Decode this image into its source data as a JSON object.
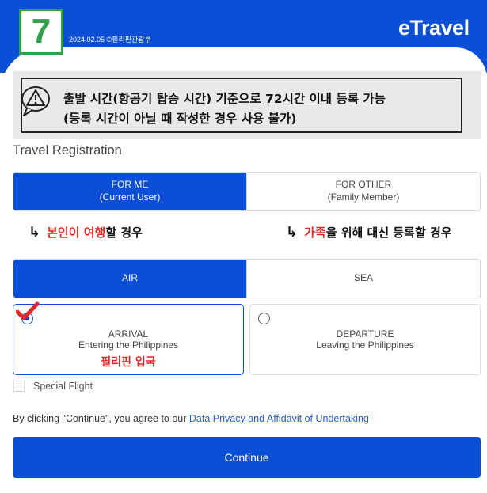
{
  "header": {
    "step_number": "7",
    "date_credit": "2024.02.05 ©필리핀관광부",
    "logo_text": "eTravel"
  },
  "notice": {
    "line1_before": "출발 시간(항공기 탑승 시간) 기준으로 ",
    "line1_highlight": "72시간 이내",
    "line1_after": " 등록 가능",
    "line2": "(등록 시간이 아닐 때 작성한 경우 사용 불가)",
    "icon": "warning-icon"
  },
  "form": {
    "title": "Travel Registration",
    "registrant": {
      "for_me_line1": "FOR ME",
      "for_me_line2": "(Current User)",
      "for_other_line1": "FOR OTHER",
      "for_other_line2": "(Family Member)",
      "selected": "FOR ME"
    },
    "notes": {
      "self_red": "본인이 여행",
      "self_rest": "할 경우",
      "family_red": "가족",
      "family_rest": "을 위해 대신 등록할 경우",
      "arrow_glyph": "↳"
    },
    "mode": {
      "air": "AIR",
      "sea": "SEA",
      "selected": "AIR"
    },
    "direction": {
      "arrival_title": "ARRIVAL",
      "arrival_sub": "Entering the Philippines",
      "arrival_ko": "필리핀 입국",
      "departure_title": "DEPARTURE",
      "departure_sub": "Leaving the Philippines",
      "selected": "ARRIVAL"
    },
    "special_flight_label": "Special Flight",
    "consent_text": "By clicking \"Continue\", you agree to our ",
    "consent_link": "Data Privacy and Affidavit of Undertaking",
    "continue_label": "Continue"
  },
  "colors": {
    "brand_blue": "#0a4fd6",
    "badge_green": "#2fa14a",
    "highlight_red": "#e22929",
    "link_blue": "#2260c9"
  }
}
